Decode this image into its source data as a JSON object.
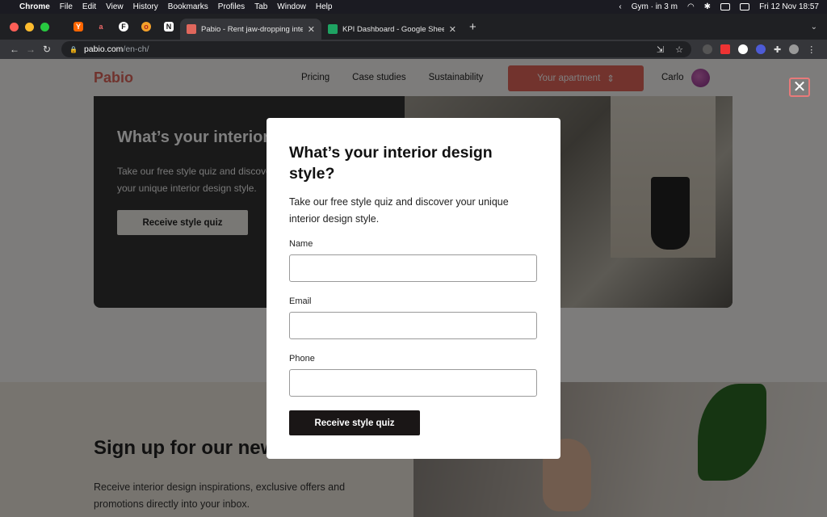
{
  "menubar": {
    "apple": "",
    "items": [
      "Chrome",
      "File",
      "Edit",
      "View",
      "History",
      "Bookmarks",
      "Profiles",
      "Tab",
      "Window",
      "Help"
    ],
    "status": "Gym · in 3 m",
    "datetime": "Fri 12 Nov  18:57"
  },
  "tabs": {
    "pinned": [
      "Y",
      "a",
      "F",
      "o",
      "N"
    ],
    "items": [
      {
        "title": "Pabio - Rent jaw-dropping inter",
        "active": true
      },
      {
        "title": "KPI Dashboard - Google Sheets",
        "active": false
      }
    ]
  },
  "address": {
    "host": "pabio.com",
    "path": "/en-ch/"
  },
  "site": {
    "logo": "Pabio",
    "nav": [
      "Pricing",
      "Case studies",
      "Sustainability"
    ],
    "apartment_button": "Your apartment",
    "user": "Carlo"
  },
  "hero": {
    "title": "What’s your interior design style?",
    "text": "Take our free style quiz and discover your unique interior design style.",
    "button": "Receive style quiz"
  },
  "signup": {
    "title": "Sign up for our newsletter",
    "text": "Receive interior design inspirations, exclusive offers and promotions directly into your inbox."
  },
  "modal": {
    "title": "What’s your interior design style?",
    "description": "Take our free style quiz and discover your unique interior design style.",
    "name_label": "Name",
    "email_label": "Email",
    "phone_label": "Phone",
    "name_value": "",
    "email_value": "",
    "phone_value": "",
    "submit": "Receive style quiz",
    "close": "✕"
  },
  "colors": {
    "brand": "#e0675c",
    "button_dark": "#1a1616"
  }
}
